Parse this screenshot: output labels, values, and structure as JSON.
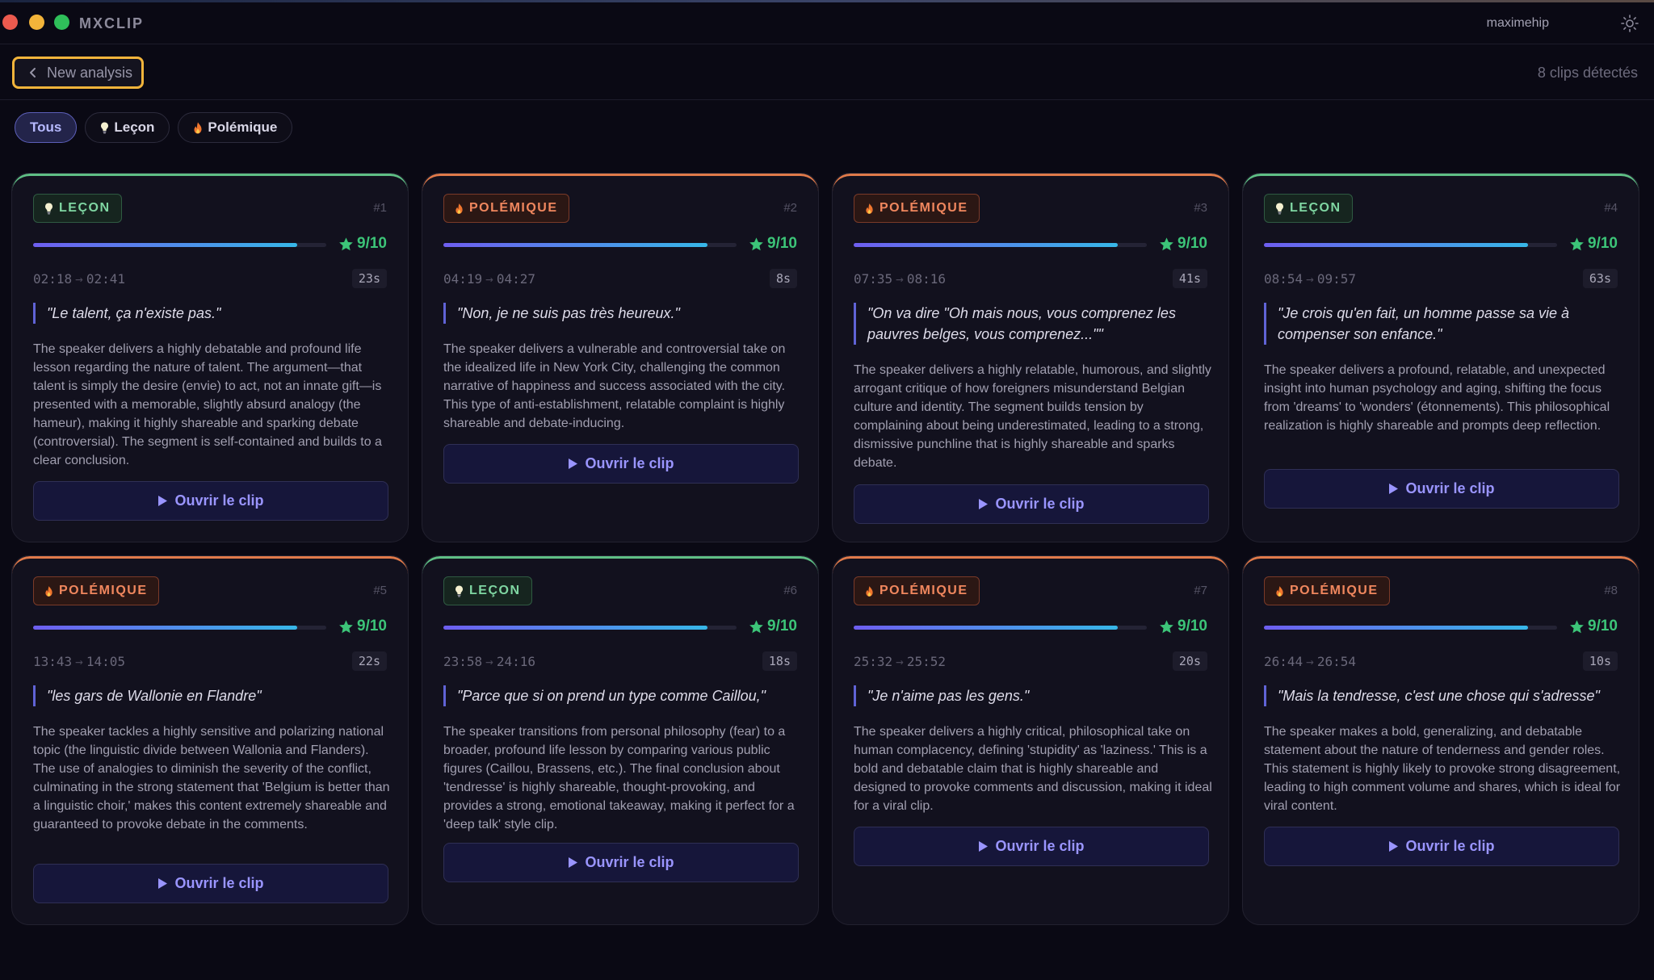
{
  "app": {
    "title": "MXCLIP",
    "username": "maximehip"
  },
  "toolbar": {
    "back_label": "New analysis",
    "clip_count": "8 clips détectés"
  },
  "filters": [
    {
      "label": "Tous",
      "icon": "",
      "active": true
    },
    {
      "label": "Leçon",
      "icon": "lightbulb-icon",
      "active": false
    },
    {
      "label": "Polémique",
      "icon": "flame-icon",
      "active": false
    }
  ],
  "open_label": "Ouvrir le clip",
  "colors": {
    "lecon": "#5fbf85",
    "polemique": "#e07a4a",
    "accent": "#6063d6",
    "score": "#3cc478",
    "highlight": "#f2b43b"
  },
  "clips": [
    {
      "num": "#1",
      "tag": "LEÇON",
      "type": "lecon",
      "score": "9/10",
      "score_value": 0.9,
      "start": "02:18",
      "end": "02:41",
      "duration": "23s",
      "quote": "\"Le talent, ça n'existe pas.\"",
      "summary": "The speaker delivers a highly debatable and profound life lesson regarding the nature of talent. The argument—that talent is simply the desire (envie) to act, not an innate gift—is presented with a memorable, slightly absurd analogy (the hameur), making it highly shareable and sparking debate (controversial). The segment is self-contained and builds to a clear conclusion."
    },
    {
      "num": "#2",
      "tag": "POLÉMIQUE",
      "type": "polemique",
      "score": "9/10",
      "score_value": 0.9,
      "start": "04:19",
      "end": "04:27",
      "duration": "8s",
      "quote": "\"Non, je ne suis pas très heureux.\"",
      "summary": "The speaker delivers a vulnerable and controversial take on the idealized life in New York City, challenging the common narrative of happiness and success associated with the city. This type of anti-establishment, relatable complaint is highly shareable and debate-inducing."
    },
    {
      "num": "#3",
      "tag": "POLÉMIQUE",
      "type": "polemique",
      "score": "9/10",
      "score_value": 0.9,
      "start": "07:35",
      "end": "08:16",
      "duration": "41s",
      "quote": "\"On va dire \"Oh mais nous, vous comprenez les pauvres belges, vous comprenez...\"\"",
      "summary": "The speaker delivers a highly relatable, humorous, and slightly arrogant critique of how foreigners misunderstand Belgian culture and identity. The segment builds tension by complaining about being underestimated, leading to a strong, dismissive punchline that is highly shareable and sparks debate."
    },
    {
      "num": "#4",
      "tag": "LEÇON",
      "type": "lecon",
      "score": "9/10",
      "score_value": 0.9,
      "start": "08:54",
      "end": "09:57",
      "duration": "63s",
      "quote": "\"Je crois qu'en fait, un homme passe sa vie à compenser son enfance.\"",
      "summary": "The speaker delivers a profound, relatable, and unexpected insight into human psychology and aging, shifting the focus from 'dreams' to 'wonders' (étonnements). This philosophical realization is highly shareable and prompts deep reflection."
    },
    {
      "num": "#5",
      "tag": "POLÉMIQUE",
      "type": "polemique",
      "score": "9/10",
      "score_value": 0.9,
      "start": "13:43",
      "end": "14:05",
      "duration": "22s",
      "quote": "\"les gars de Wallonie en Flandre\"",
      "summary": "The speaker tackles a highly sensitive and polarizing national topic (the linguistic divide between Wallonia and Flanders). The use of analogies to diminish the severity of the conflict, culminating in the strong statement that 'Belgium is better than a linguistic choir,' makes this content extremely shareable and guaranteed to provoke debate in the comments."
    },
    {
      "num": "#6",
      "tag": "LEÇON",
      "type": "lecon",
      "score": "9/10",
      "score_value": 0.9,
      "start": "23:58",
      "end": "24:16",
      "duration": "18s",
      "quote": "\"Parce que si on prend un type comme Caillou,\"",
      "summary": "The speaker transitions from personal philosophy (fear) to a broader, profound life lesson by comparing various public figures (Caillou, Brassens, etc.). The final conclusion about 'tendresse' is highly shareable, thought-provoking, and provides a strong, emotional takeaway, making it perfect for a 'deep talk' style clip."
    },
    {
      "num": "#7",
      "tag": "POLÉMIQUE",
      "type": "polemique",
      "score": "9/10",
      "score_value": 0.9,
      "start": "25:32",
      "end": "25:52",
      "duration": "20s",
      "quote": "\"Je n'aime pas les gens.\"",
      "summary": "The speaker delivers a highly critical, philosophical take on human complacency, defining 'stupidity' as 'laziness.' This is a bold and debatable claim that is highly shareable and designed to provoke comments and discussion, making it ideal for a viral clip."
    },
    {
      "num": "#8",
      "tag": "POLÉMIQUE",
      "type": "polemique",
      "score": "9/10",
      "score_value": 0.9,
      "start": "26:44",
      "end": "26:54",
      "duration": "10s",
      "quote": "\"Mais la tendresse, c'est une chose qui s'adresse\"",
      "summary": "The speaker makes a bold, generalizing, and debatable statement about the nature of tenderness and gender roles. This statement is highly likely to provoke strong disagreement, leading to high comment volume and shares, which is ideal for viral content."
    }
  ]
}
